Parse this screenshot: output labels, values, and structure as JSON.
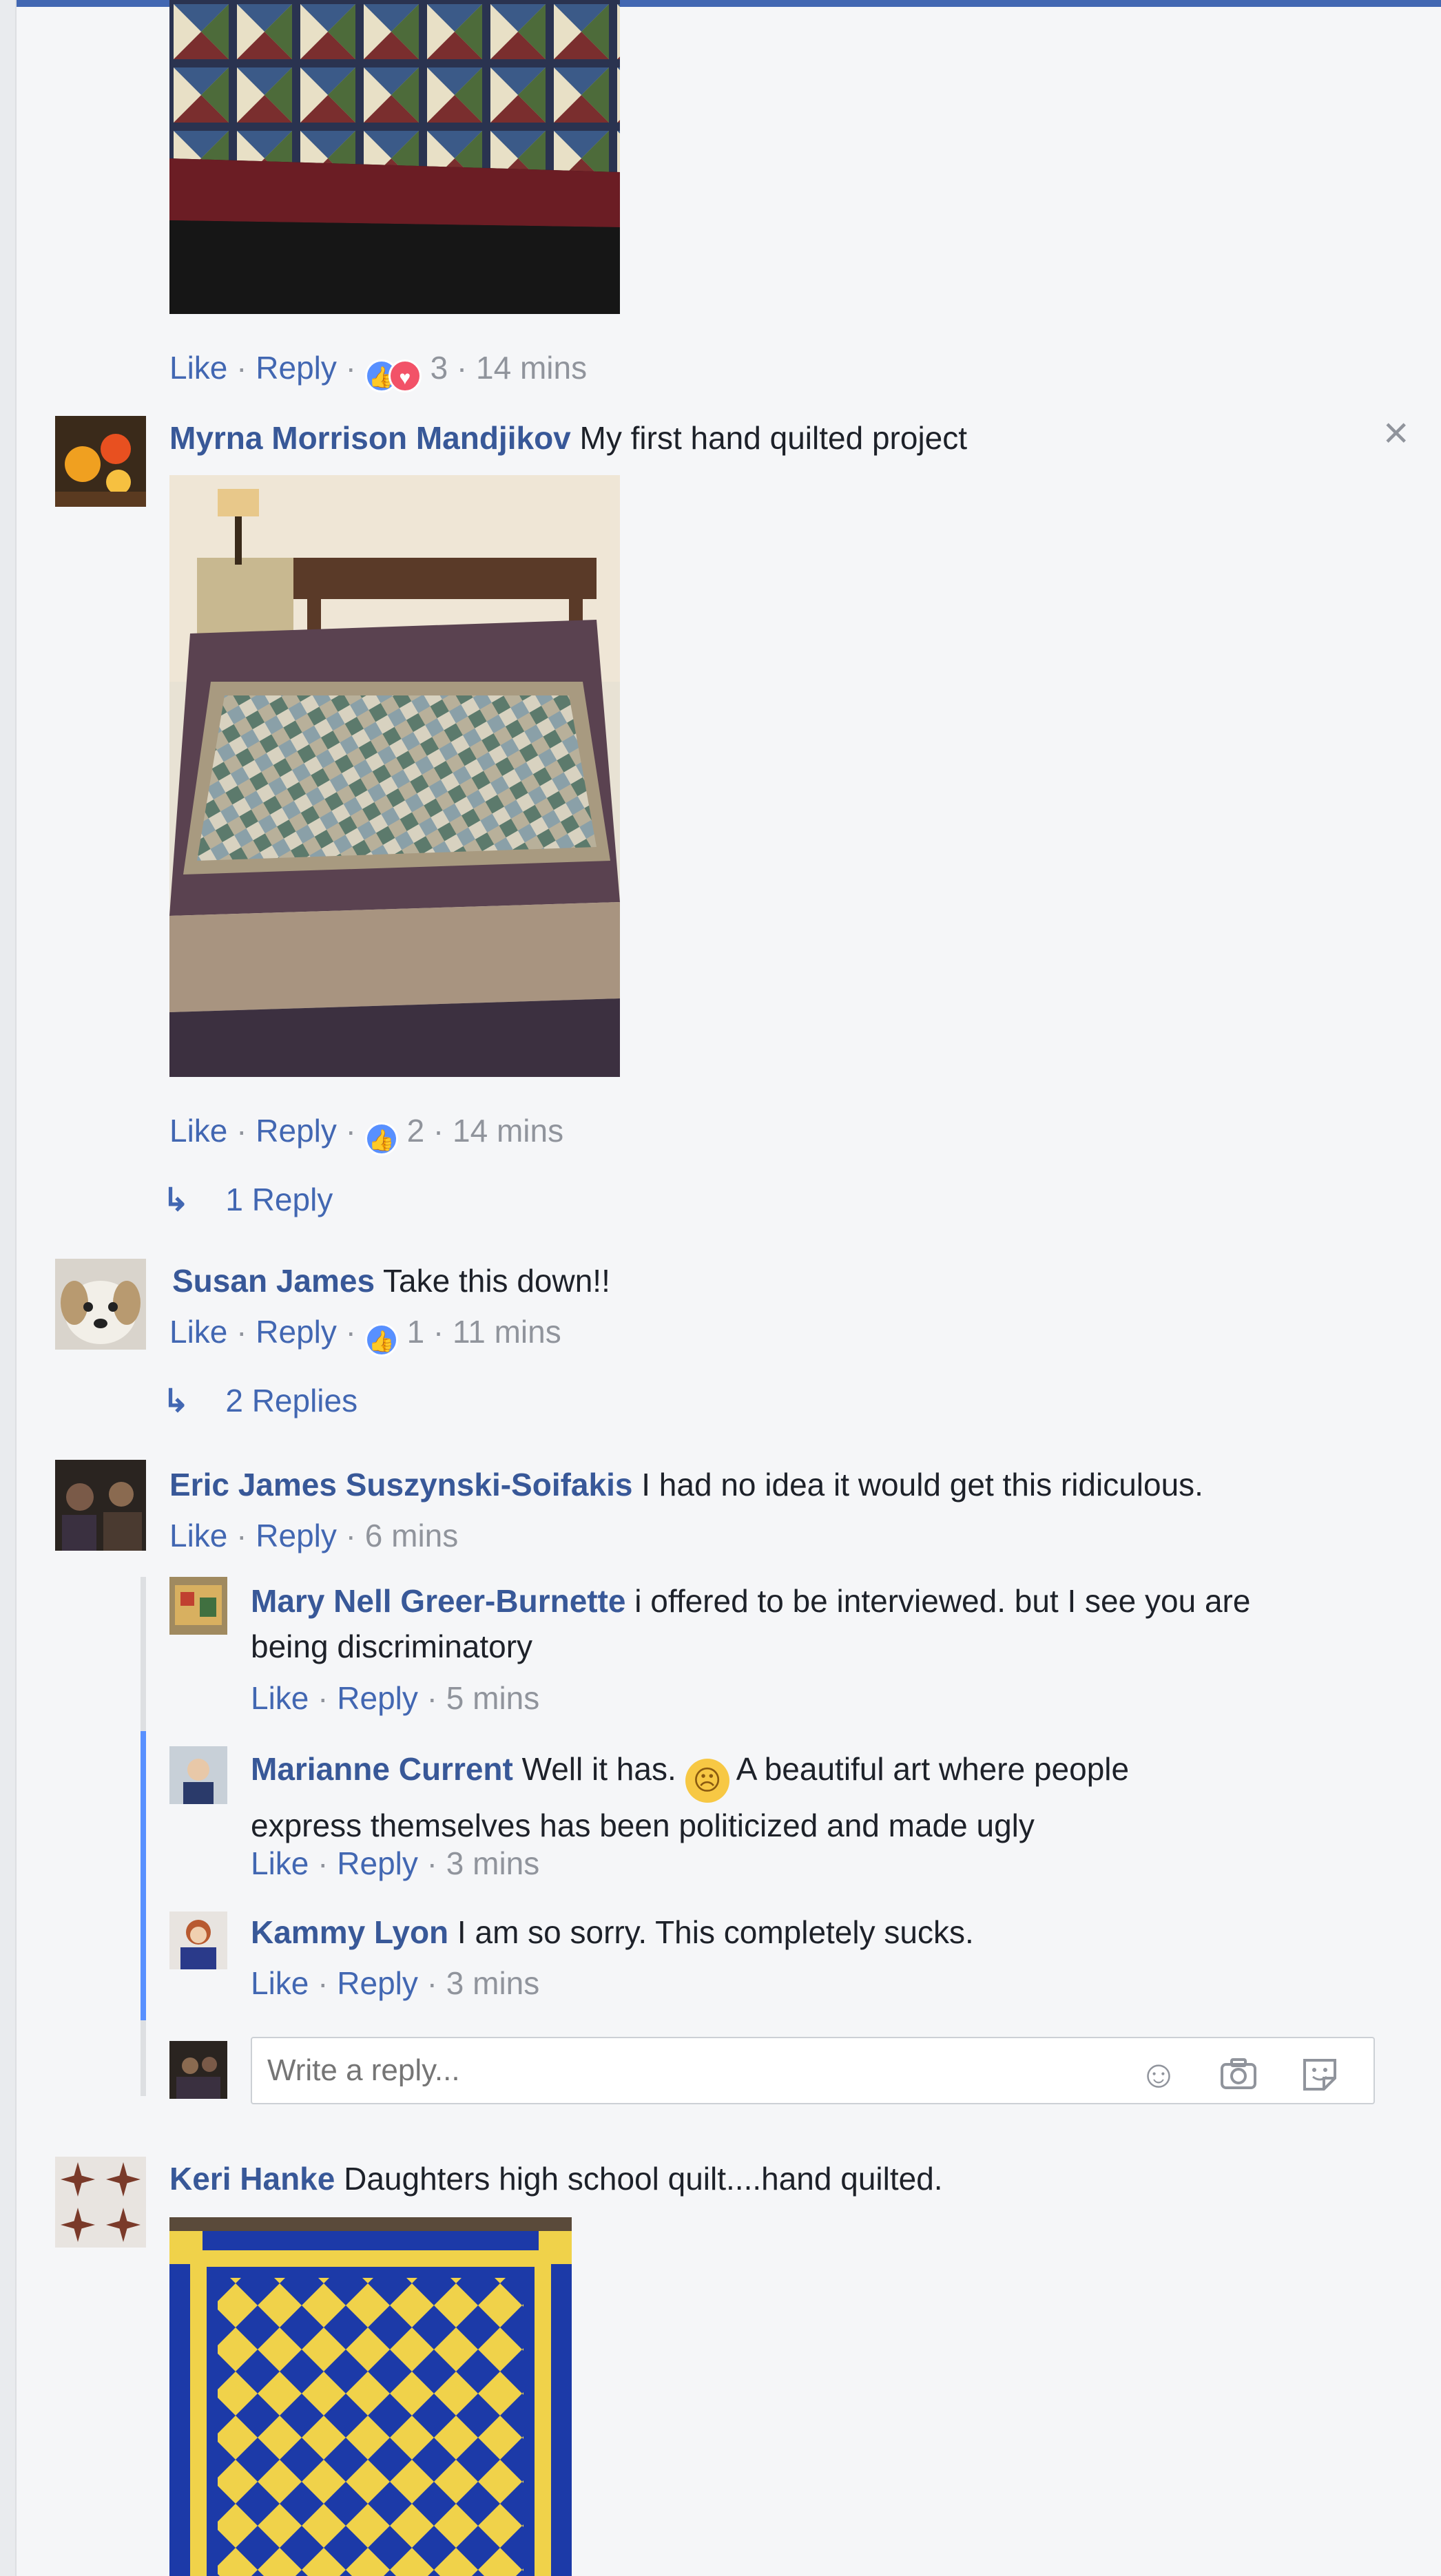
{
  "colors": {
    "link": "#4267b2",
    "name": "#385898",
    "meta": "#90949c",
    "like_reaction": "#5890ff",
    "love_reaction": "#f25268",
    "thread_line": "#5890ff"
  },
  "icons": {
    "like": "thumbs-up-icon",
    "love": "heart-icon",
    "reply_arrow": "reply-arrow-icon",
    "close": "close-icon",
    "emoji": "smiley-icon",
    "camera": "camera-icon",
    "sticker": "sticker-icon"
  },
  "top_comment": {
    "actions": {
      "like": "Like",
      "reply": "Reply",
      "reaction_count": "3",
      "time": "14 mins"
    }
  },
  "comments": [
    {
      "author": "Myrna Morrison Mandjikov",
      "text": "My first hand quilted project",
      "actions": {
        "like": "Like",
        "reply": "Reply",
        "reaction_count": "2",
        "time": "14 mins"
      },
      "replies_link": "1 Reply"
    },
    {
      "author": "Susan James",
      "text": "Take this down!!",
      "actions": {
        "like": "Like",
        "reply": "Reply",
        "reaction_count": "1",
        "time": "11 mins"
      },
      "replies_link": "2 Replies"
    },
    {
      "author": "Eric James Suszynski-Soifakis",
      "text": "I had no idea it would get this ridiculous.",
      "actions": {
        "like": "Like",
        "reply": "Reply",
        "time": "6 mins"
      },
      "replies": [
        {
          "author": "Mary Nell Greer-Burnette",
          "text_line1": "i offered to be interviewed. but I see you are",
          "text_line2": "being discriminatory",
          "actions": {
            "like": "Like",
            "reply": "Reply",
            "time": "5 mins"
          }
        },
        {
          "author": "Marianne Current",
          "text_line1a": "Well it has.",
          "text_line1b": "A beautiful art where people",
          "text_line2": "express themselves has been politicized and made ugly",
          "actions": {
            "like": "Like",
            "reply": "Reply",
            "time": "3 mins"
          }
        },
        {
          "author": "Kammy Lyon",
          "text": "I am so sorry. This completely sucks.",
          "actions": {
            "like": "Like",
            "reply": "Reply",
            "time": "3 mins"
          }
        }
      ],
      "reply_box": {
        "placeholder": "Write a reply..."
      }
    },
    {
      "author": "Keri Hanke",
      "text": "Daughters high school quilt....hand quilted."
    }
  ],
  "separator": " · "
}
